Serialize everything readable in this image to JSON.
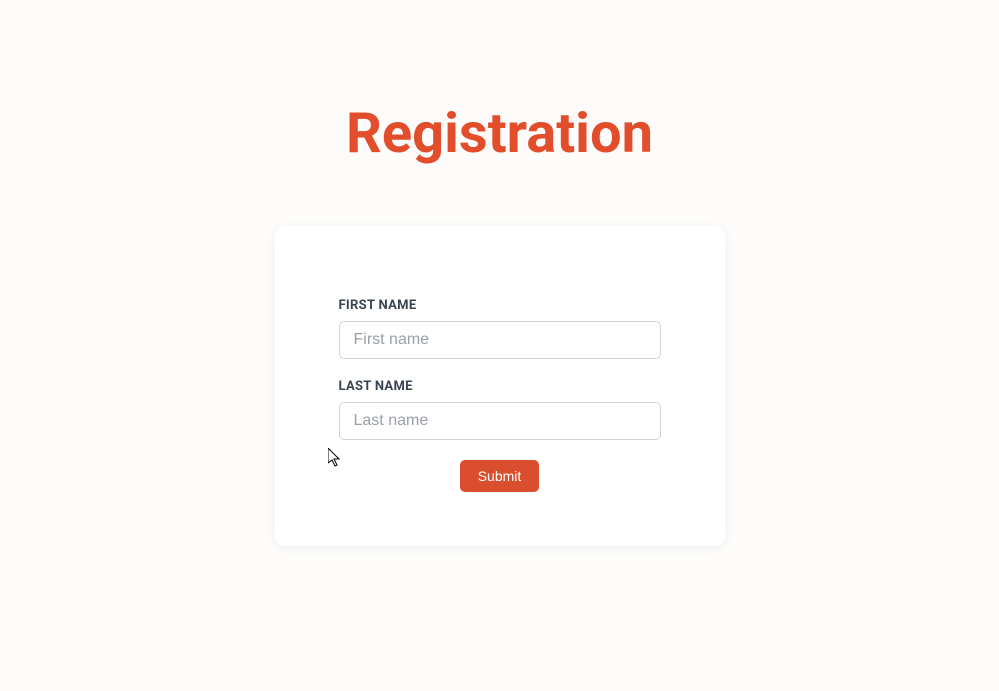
{
  "page": {
    "title": "Registration"
  },
  "form": {
    "fields": {
      "first_name": {
        "label": "FIRST NAME",
        "placeholder": "First name",
        "value": ""
      },
      "last_name": {
        "label": "LAST NAME",
        "placeholder": "Last name",
        "value": ""
      }
    },
    "submit_label": "Submit"
  },
  "colors": {
    "accent": "#e24e2b",
    "button": "#db4e2d"
  }
}
